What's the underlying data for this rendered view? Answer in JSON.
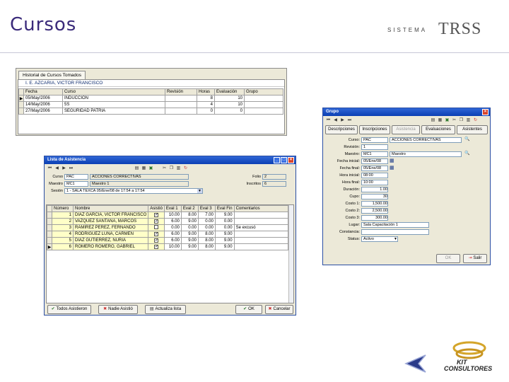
{
  "slide": {
    "title": "Cursos"
  },
  "logo": {
    "small": "SISTEMA",
    "big": "TRSS"
  },
  "historial": {
    "tab": "Historial de Cursos Tomados",
    "person": "I. E. AZCARIA, VICTOR FRANCISCO",
    "columns": [
      "Fecha",
      "Curso",
      "Revisión",
      "Horas",
      "Evaluación",
      "Grupo"
    ],
    "rows": [
      [
        "05/May/2006",
        "INDUCCION",
        "",
        "8",
        "10",
        ""
      ],
      [
        "14/May/2006",
        "5S",
        "",
        "4",
        "10",
        ""
      ],
      [
        "27/May/2006",
        "SEGURIDAD PATRIA",
        "",
        "0",
        "0",
        ""
      ]
    ]
  },
  "asistencia": {
    "title": "Lista de Asistencia",
    "labels": {
      "curso": "Curso",
      "maestro": "Maestro",
      "sesion": "Sesión",
      "folio": "Folio",
      "inscritos": "Inscritos"
    },
    "values": {
      "curso_code": "PAC",
      "curso_name": "ACCIONES CORRECTIVAS",
      "maestro_code": "MC1",
      "maestro_name": "Maestro 1",
      "sesion": "1 - SALA TEXCA 05/Ene/08 de 17:54 a 17:54",
      "folio": "2",
      "inscritos": "6"
    },
    "columns": [
      "Número",
      "Nombre",
      "Asistió",
      "Eval 1",
      "Eval 2",
      "Eval 3",
      "Eval Fin",
      "Comentarios"
    ],
    "rows": [
      [
        "1",
        "DIAZ GARCIA, VICTOR FRANCISCO",
        "✓",
        "10.00",
        "8.00",
        "7.00",
        "9.00",
        ""
      ],
      [
        "2",
        "VAZQUEZ SANTANA, MARCOS",
        "✓",
        "6.00",
        "9.00",
        "0.00",
        "0.00",
        ""
      ],
      [
        "3",
        "RAMIREZ PEREZ, FERNANDO",
        "",
        "0.00",
        "0.00",
        "0.00",
        "0.00",
        "Se excusó"
      ],
      [
        "4",
        "RODRIGUEZ LUNA, CARMEN",
        "✓",
        "6.00",
        "9.00",
        "8.00",
        "9.00",
        ""
      ],
      [
        "5",
        "DIAZ GUTIERREZ, NURIA",
        "✓",
        "6.00",
        "9.00",
        "8.00",
        "9.00",
        ""
      ],
      [
        "6",
        "ROMERO ROMERO, GABRIEL",
        "✓",
        "10.00",
        "9.00",
        "8.00",
        "9.00",
        ""
      ]
    ],
    "buttons": {
      "todos": "Todos Asistieron",
      "nadie": "Nadie Asistió",
      "actualiza": "Actualiza lista",
      "ok": "OK",
      "cancel": "Cancelar"
    }
  },
  "grupo": {
    "title": "Grupo",
    "tabs": [
      "Descripciones",
      "Inscripciones",
      "Asistencia",
      "Evaluaciones",
      "Asistentes"
    ],
    "fields": [
      {
        "label": "Curso:",
        "code": "PAC",
        "value": "ACCIONES CORRECTIVAS"
      },
      {
        "label": "Revisión:",
        "code": "1",
        "value": ""
      },
      {
        "label": "Maestro:",
        "code": "MC1",
        "value": "Maestro"
      },
      {
        "label": "Fecha inicial:",
        "code": "05/Ene/08",
        "value": ""
      },
      {
        "label": "Fecha final:",
        "code": "05/Ene/08",
        "value": ""
      },
      {
        "label": "Hora inicial:",
        "code": "08:00",
        "value": ""
      },
      {
        "label": "Hora final:",
        "code": "10:00",
        "value": ""
      },
      {
        "label": "Duración:",
        "code": "1.00",
        "value": ""
      },
      {
        "label": "Cupo:",
        "code": "30",
        "value": ""
      },
      {
        "label": "Costo 1:",
        "code": "1,500.00",
        "value": ""
      },
      {
        "label": "Costo 2:",
        "code": "2,500.00",
        "value": ""
      },
      {
        "label": "Costo 3:",
        "code": "300.00",
        "value": ""
      },
      {
        "label": "Lugar:",
        "code": "Sala Capacitación 1",
        "value": ""
      },
      {
        "label": "Constancia:",
        "code": "",
        "value": ""
      },
      {
        "label": "Status:",
        "code": "Activo",
        "value": ""
      }
    ],
    "buttons": {
      "ok": "OK",
      "exit": "Salir"
    }
  },
  "footer": {
    "brand_top": "KIT",
    "brand_bottom": "CONSULTORES"
  }
}
